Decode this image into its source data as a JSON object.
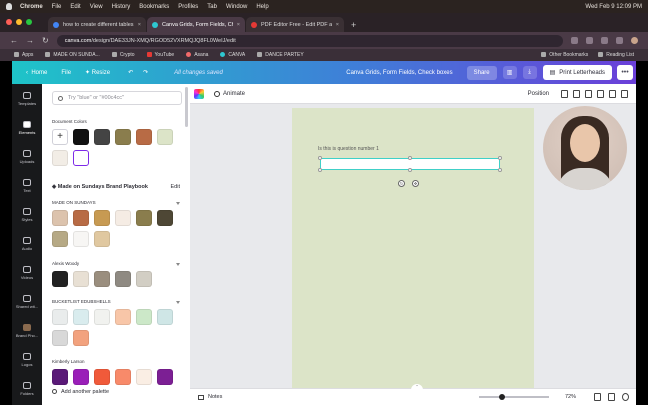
{
  "menubar": {
    "items": [
      "Chrome",
      "File",
      "Edit",
      "View",
      "History",
      "Bookmarks",
      "Profiles",
      "Tab",
      "Window",
      "Help"
    ],
    "clock": "Wed Feb 9 12:09 PM"
  },
  "tabs": [
    {
      "title": "how to create different tables",
      "favicon_color": "#4285f4",
      "active": false
    },
    {
      "title": "Canva Grids, Form Fields, Ch",
      "favicon_color": "#2ec7d0",
      "active": true
    },
    {
      "title": "PDF Editor Free - Edit PDF an",
      "favicon_color": "#e53935",
      "active": false
    }
  ],
  "address": {
    "host": "canva.com",
    "path": "/design/DAE33JN-XMQ/RGOD52VXRMQJQ8FL0WeIJ/edit"
  },
  "bookmarks": {
    "items": [
      "Apps",
      "MADE ON SUNDA...",
      "Crypto",
      "YouTube",
      "Asana",
      "CANVA",
      "DANCE PARTEY"
    ],
    "right": [
      "Other Bookmarks",
      "Reading List"
    ]
  },
  "canva_header": {
    "home": "Home",
    "file": "File",
    "resize": "Resize",
    "saved": "All changes saved",
    "doc_title": "Canva Grids, Form Fields, Check boxes",
    "share": "Share",
    "print": "Print Letterheads"
  },
  "rail": [
    {
      "label": "Templates",
      "active": false
    },
    {
      "label": "Elements",
      "active": true
    },
    {
      "label": "Uploads",
      "active": false
    },
    {
      "label": "Text",
      "active": false
    },
    {
      "label": "Styles",
      "active": false
    },
    {
      "label": "Audio",
      "active": false
    },
    {
      "label": "Videos",
      "active": false
    },
    {
      "label": "Shared wit...",
      "active": false
    },
    {
      "label": "Brand Pho...",
      "active": false
    },
    {
      "label": "Logos",
      "active": false
    },
    {
      "label": "Folders",
      "active": false
    }
  ],
  "panel": {
    "search_placeholder": "Try \"blue\" or \"#00c4cc\"",
    "document_colors_label": "Document Colors",
    "brand_kit_label": "Made on Sundays Brand Playbook",
    "edit_label": "Edit",
    "palettes": [
      {
        "name": "MADE ON SUNDAYS",
        "colors": [
          "#dcc3ad",
          "#b86b45",
          "#c79a52",
          "#f5ece4",
          "#8a7d4d",
          "#4e4735",
          "#b6a985",
          "#f7f6f4",
          "#e0c8a0"
        ]
      },
      {
        "name": "Alexis Woody",
        "colors": [
          "#222222",
          "#e8e0d4",
          "#9a8e7e",
          "#8f8a82",
          "#d2cec4"
        ]
      },
      {
        "name": "BUCKETLIST EDUBSHELLS",
        "colors": [
          "#e9ecec",
          "#d9ecee",
          "#f1f2ef",
          "#f8c6a8",
          "#cce8c8",
          "#cfe6e6",
          "#d8d8d8",
          "#f2a27e"
        ]
      },
      {
        "name": "Kimberly Larson",
        "colors": [
          "#5a1a78",
          "#9a1fb8",
          "#f05a3a",
          "#f88a6a",
          "#faeee4",
          "#7c1f94"
        ]
      }
    ],
    "document_colors": [
      "#111111",
      "#444444",
      "#8a7d4d",
      "#b86b45",
      "#dce4c8",
      "#f2ede6",
      "#ffffff"
    ],
    "add_palette": "Add another palette"
  },
  "context_bar": {
    "animate": "Animate",
    "position": "Position"
  },
  "canvas": {
    "page_color": "#dce4c8",
    "question_label": "Is this is question number 1",
    "field_border": "#40d0c8"
  },
  "bottom_bar": {
    "notes": "Notes",
    "zoom": "72%"
  }
}
